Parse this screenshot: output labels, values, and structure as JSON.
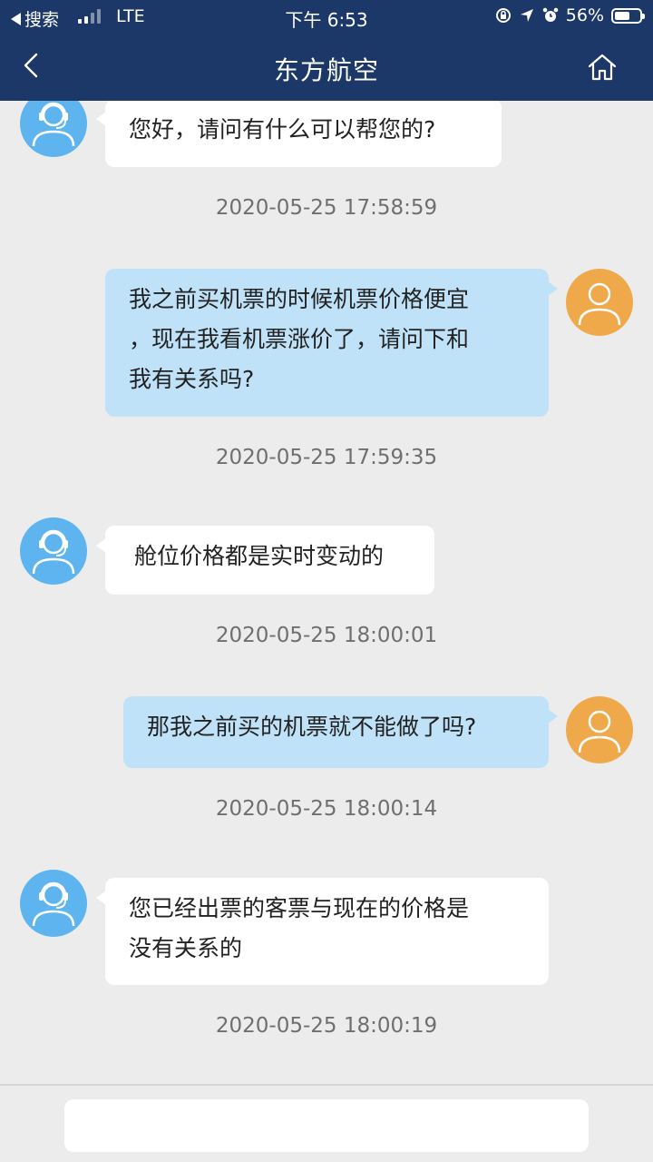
{
  "status_bar": {
    "back_app_label": "搜索",
    "network": "LTE",
    "time": "下午 6:53",
    "battery": "56%"
  },
  "nav": {
    "title": "东方航空",
    "back_icon": "chevron-left-icon",
    "home_icon": "home-icon"
  },
  "messages": [
    {
      "sender": "agent",
      "lines": [
        "您好，请问有什么可以帮您的?"
      ],
      "time": "2020-05-25 17:58:59"
    },
    {
      "sender": "user",
      "lines": [
        "我之前买机票的时候机票价格便宜",
        "，现在我看机票涨价了，请问下和",
        "我有关系吗?"
      ],
      "time": "2020-05-25 17:59:35"
    },
    {
      "sender": "agent",
      "lines": [
        "舱位价格都是实时变动的"
      ],
      "time": "2020-05-25 18:00:01"
    },
    {
      "sender": "user",
      "lines": [
        "那我之前买的机票就不能做了吗?"
      ],
      "time": "2020-05-25 18:00:14"
    },
    {
      "sender": "agent",
      "lines": [
        "您已经出票的客票与现在的价格是",
        "没有关系的"
      ],
      "time": "2020-05-25 18:00:19"
    }
  ],
  "input": {
    "value": "",
    "placeholder": ""
  },
  "colors": {
    "header": "#1c3868",
    "agent_avatar": "#5db4ee",
    "user_avatar": "#f0a94a",
    "user_bubble": "#bfe2f8",
    "agent_bubble": "#ffffff",
    "background": "#ececec"
  }
}
